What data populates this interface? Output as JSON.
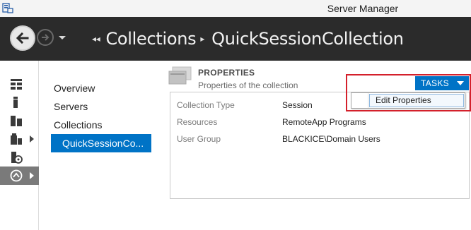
{
  "window": {
    "title": "Server Manager"
  },
  "breadcrumb": {
    "items": [
      "Collections",
      "QuickSessionCollection"
    ]
  },
  "rail": {
    "items": [
      {
        "icon": "dashboard-icon"
      },
      {
        "icon": "local-server-icon"
      },
      {
        "icon": "all-servers-icon"
      },
      {
        "icon": "file-storage-icon",
        "has_arrow": true
      },
      {
        "icon": "iis-icon"
      },
      {
        "icon": "remote-desktop-services-icon",
        "has_arrow": true,
        "active": true
      }
    ]
  },
  "nav": {
    "items": [
      {
        "label": "Overview"
      },
      {
        "label": "Servers"
      },
      {
        "label": "Collections"
      },
      {
        "label": "QuickSessionCo...",
        "selected": true
      }
    ]
  },
  "properties": {
    "title": "PROPERTIES",
    "subtitle": "Properties of the collection",
    "rows": [
      {
        "key": "Collection Type",
        "value": "Session"
      },
      {
        "key": "Resources",
        "value": "RemoteApp Programs"
      },
      {
        "key": "User Group",
        "value": "BLACKICE\\Domain Users"
      }
    ]
  },
  "tasks": {
    "label": "TASKS",
    "menu": [
      {
        "label": "Edit Properties"
      }
    ]
  },
  "colors": {
    "accent": "#0073c6",
    "header_bg": "#2b2b2b",
    "highlight": "#d4202b"
  }
}
